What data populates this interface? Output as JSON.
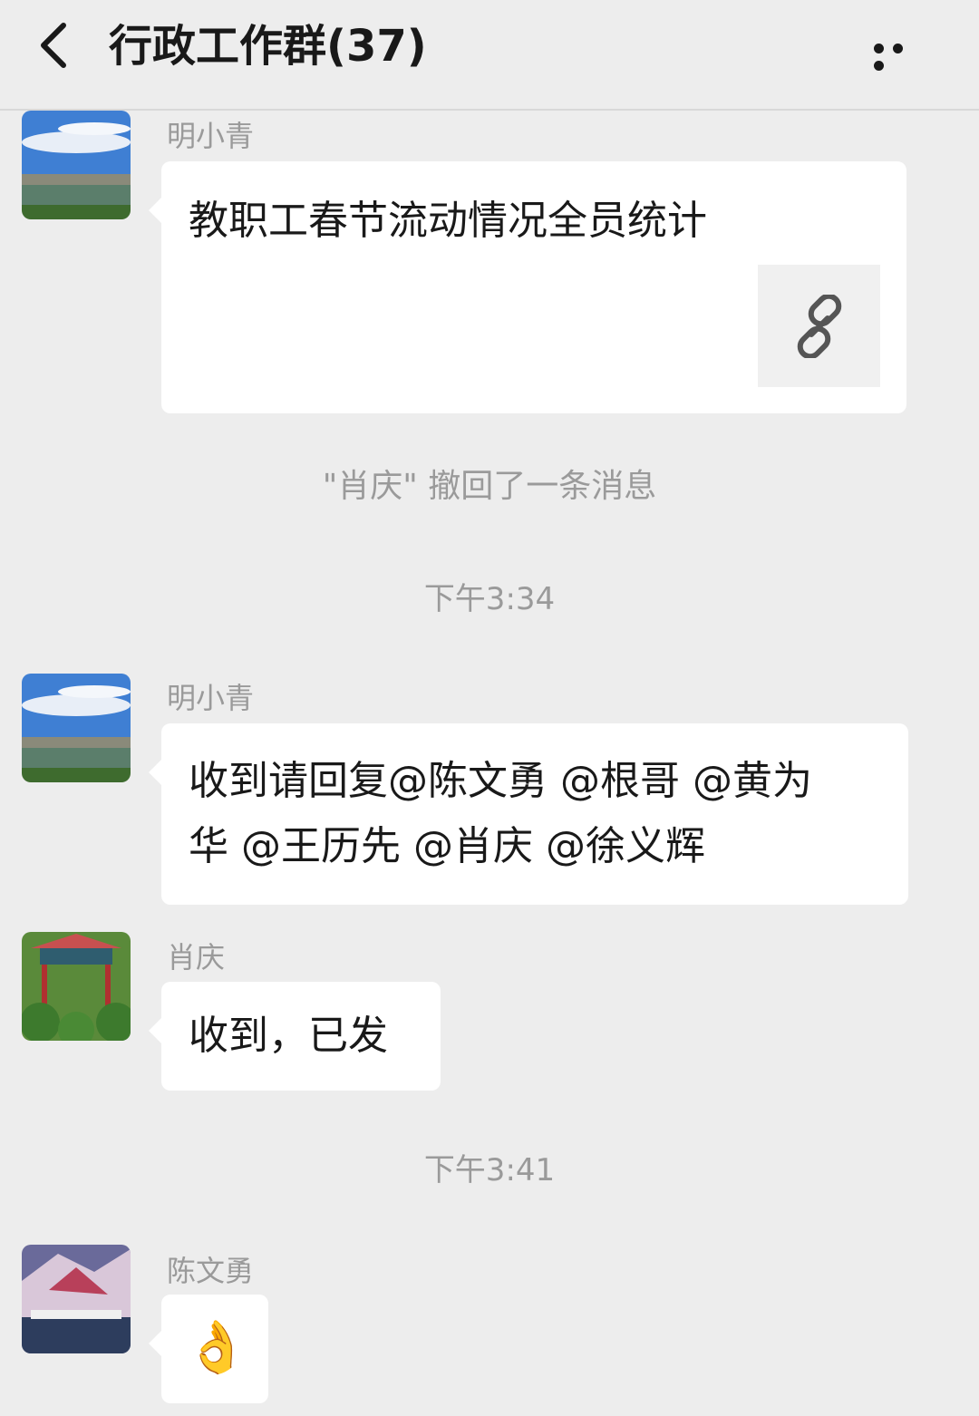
{
  "header": {
    "title": "行政工作群(37)"
  },
  "messages": [
    {
      "sender": "明小青",
      "type": "link",
      "title": "教职工春节流动情况全员统计",
      "icon": "link-icon"
    },
    {
      "type": "system",
      "text": "\"肖庆\" 撤回了一条消息"
    },
    {
      "type": "time",
      "text": "下午3:34"
    },
    {
      "sender": "明小青",
      "type": "text",
      "line1": "收到请回复@陈文勇 @根哥 @黄为",
      "line2": "华 @王历先 @肖庆 @徐义辉"
    },
    {
      "sender": "肖庆",
      "type": "text",
      "text": "收到，已发"
    },
    {
      "type": "time",
      "text": "下午3:41"
    },
    {
      "sender": "陈文勇",
      "type": "emoji",
      "text": "👌"
    }
  ],
  "colors": {
    "background": "#ededed",
    "bubble": "#ffffff",
    "meta_text": "#9a9a9a",
    "body_text": "#191919"
  }
}
